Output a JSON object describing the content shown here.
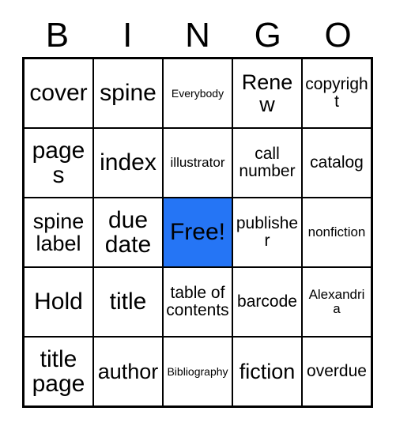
{
  "card": {
    "title_letters": [
      "B",
      "I",
      "N",
      "G",
      "O"
    ],
    "free_space_color": "#2575f5",
    "grid_line_color": "#000000",
    "background_color": "#ffffff",
    "columns": 5,
    "rows": 5,
    "cells": [
      [
        {
          "label": "cover",
          "size": "xl",
          "free": false
        },
        {
          "label": "spine",
          "size": "xl",
          "free": false
        },
        {
          "label": "Everybody",
          "size": "xs",
          "free": false
        },
        {
          "label": "Renew",
          "size": "lg",
          "free": false
        },
        {
          "label": "copyright",
          "size": "md",
          "free": false
        }
      ],
      [
        {
          "label": "pages",
          "size": "xl",
          "free": false
        },
        {
          "label": "index",
          "size": "xl",
          "free": false
        },
        {
          "label": "illustrator",
          "size": "sm",
          "free": false
        },
        {
          "label": "call number",
          "size": "md",
          "free": false
        },
        {
          "label": "catalog",
          "size": "md",
          "free": false
        }
      ],
      [
        {
          "label": "spine label",
          "size": "lg",
          "free": false
        },
        {
          "label": "due date",
          "size": "xl",
          "free": false
        },
        {
          "label": "Free!",
          "size": "xl",
          "free": true
        },
        {
          "label": "publisher",
          "size": "md",
          "free": false
        },
        {
          "label": "nonfiction",
          "size": "sm",
          "free": false
        }
      ],
      [
        {
          "label": "Hold",
          "size": "xl",
          "free": false
        },
        {
          "label": "title",
          "size": "xl",
          "free": false
        },
        {
          "label": "table of contents",
          "size": "md",
          "free": false
        },
        {
          "label": "barcode",
          "size": "md",
          "free": false
        },
        {
          "label": "Alexandria",
          "size": "sm",
          "free": false
        }
      ],
      [
        {
          "label": "title page",
          "size": "xl",
          "free": false
        },
        {
          "label": "author",
          "size": "lg",
          "free": false
        },
        {
          "label": "Bibliography",
          "size": "xs",
          "free": false
        },
        {
          "label": "fiction",
          "size": "lg",
          "free": false
        },
        {
          "label": "overdue",
          "size": "md",
          "free": false
        }
      ]
    ]
  }
}
